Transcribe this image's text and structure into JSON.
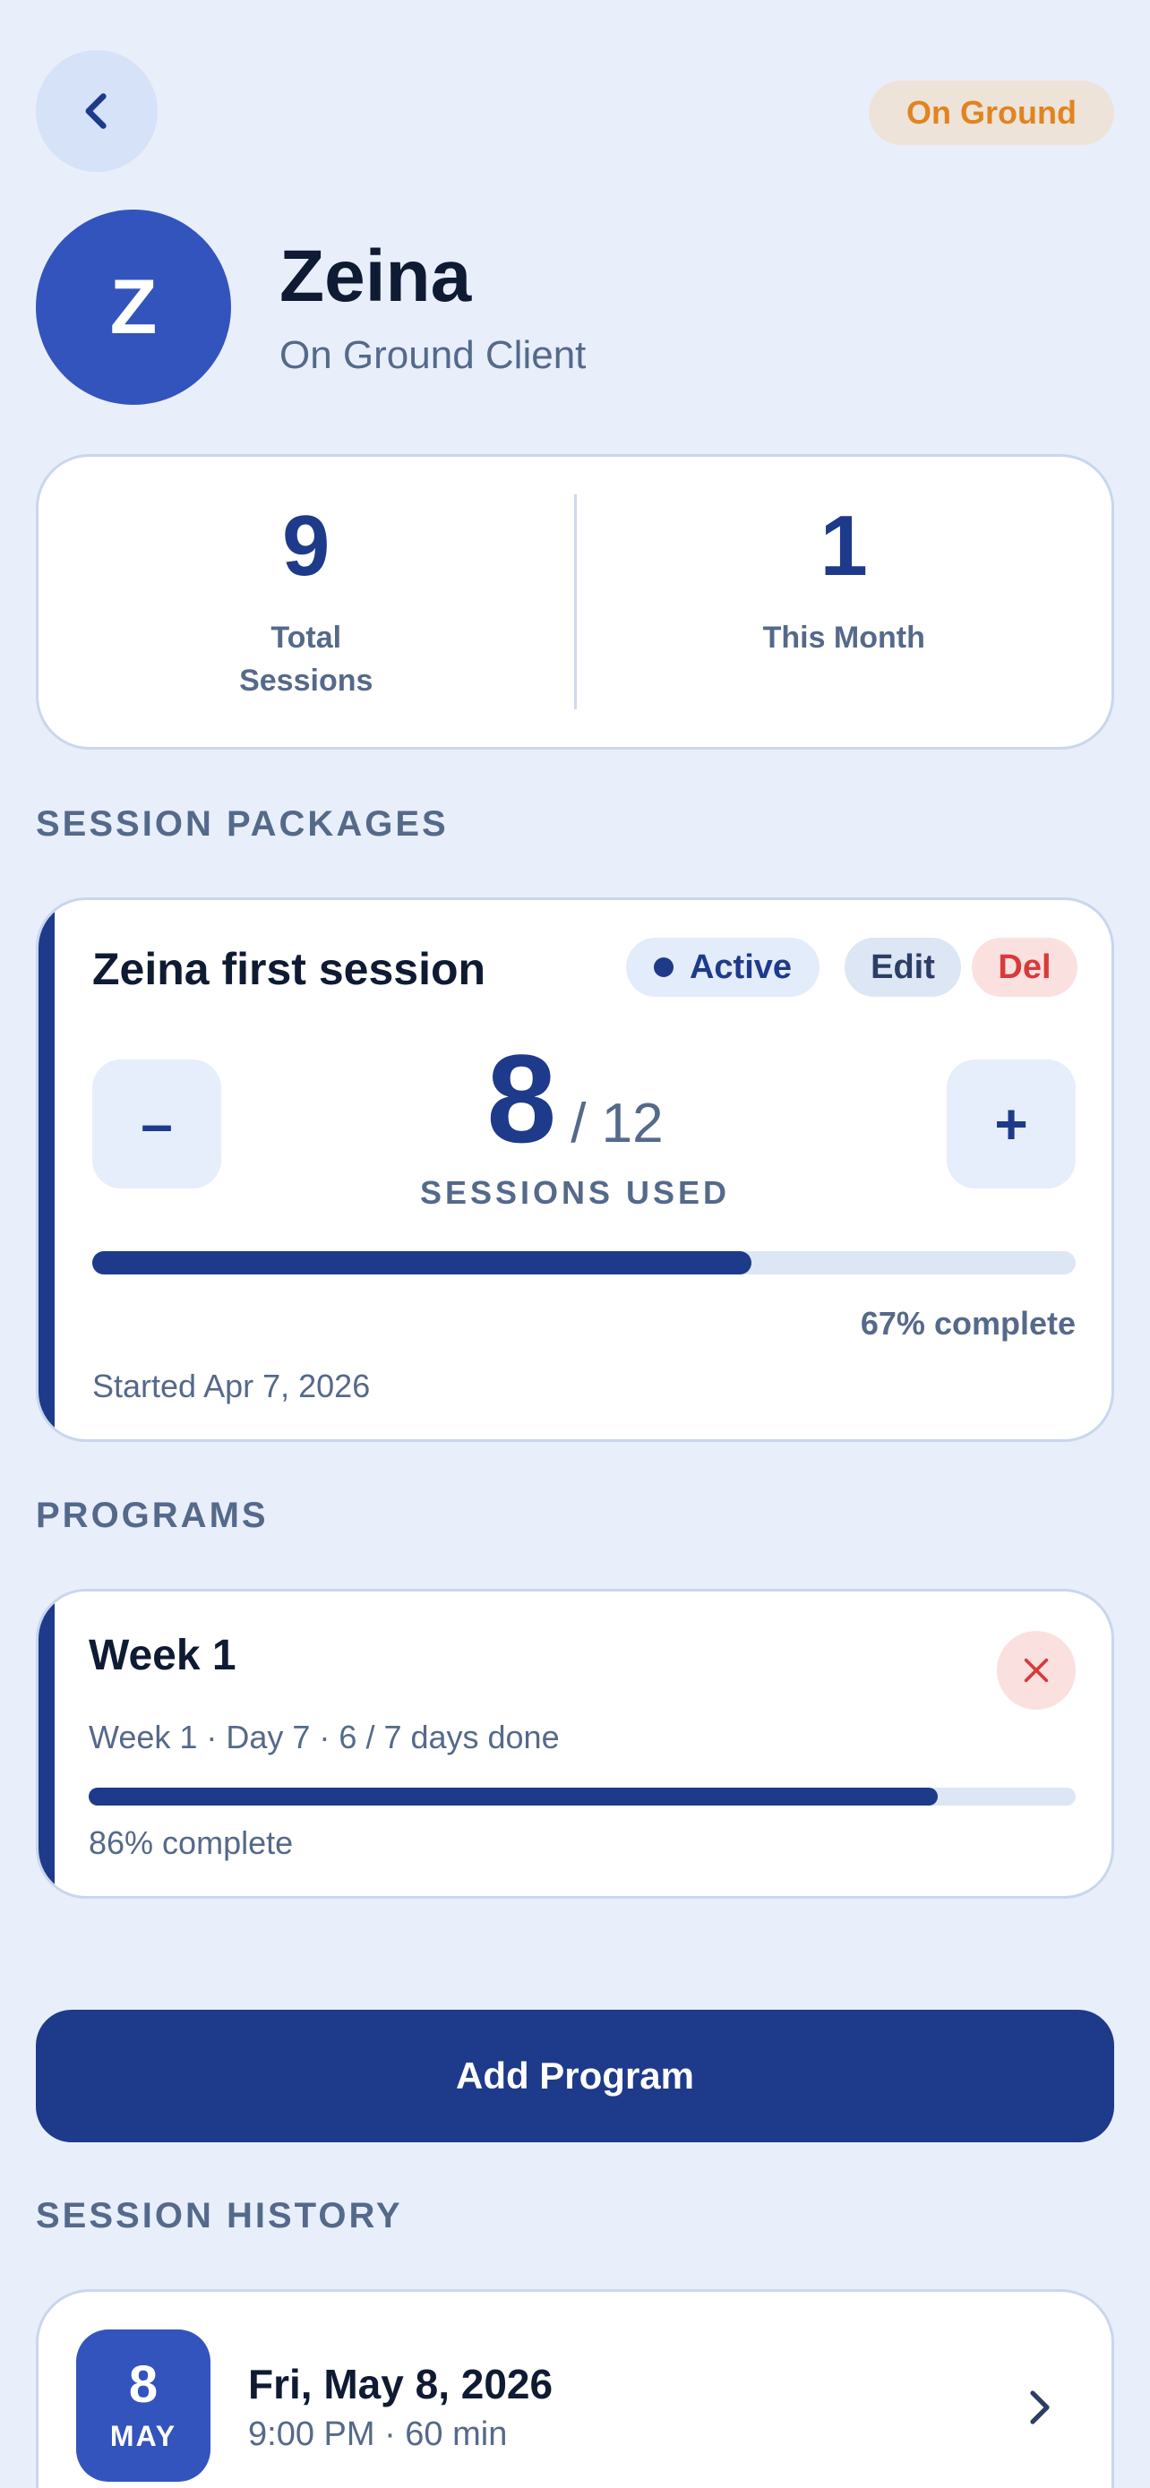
{
  "header": {
    "back_icon": "chevron-left-icon",
    "client_type_badge": "On Ground",
    "avatar_initial": "Z",
    "client_name": "Zeina",
    "client_type": "On Ground Client"
  },
  "stats": [
    {
      "value": "9",
      "label": "Total Sessions"
    },
    {
      "value": "1",
      "label": "This Month"
    }
  ],
  "session_packages": {
    "section_title": "SESSION PACKAGES",
    "package": {
      "title": "Zeina first session",
      "status": "Active",
      "edit_label": "Edit",
      "delete_label": "Del",
      "decrement_label": "–",
      "increment_label": "+",
      "used": "8",
      "total": "/ 12",
      "used_label": "SESSIONS USED",
      "progress": 0.67,
      "progress_label": "67% complete",
      "started": "Started Apr 7, 2026"
    }
  },
  "programs": {
    "section_title": "PROGRAMS",
    "items": [
      {
        "title": "Week 1",
        "meta": "Week 1 · Day 7  ·  6 / 7 days done",
        "progress": 0.86,
        "progress_label": "86% complete",
        "remove_icon": "close-icon"
      }
    ],
    "add_button": "Add Program"
  },
  "session_history": {
    "section_title": "SESSION HISTORY",
    "items": [
      {
        "day": "8",
        "month": "MAY",
        "date": "Fri, May 8, 2026",
        "time": "9:00 PM · 60 min",
        "chevron_icon": "chevron-right-icon"
      }
    ]
  },
  "colors": {
    "background": "#e8effb",
    "primary": "#1e3a8a",
    "avatar": "#3354bd",
    "badge_orange": "#e08420",
    "danger": "#d83a3a"
  }
}
